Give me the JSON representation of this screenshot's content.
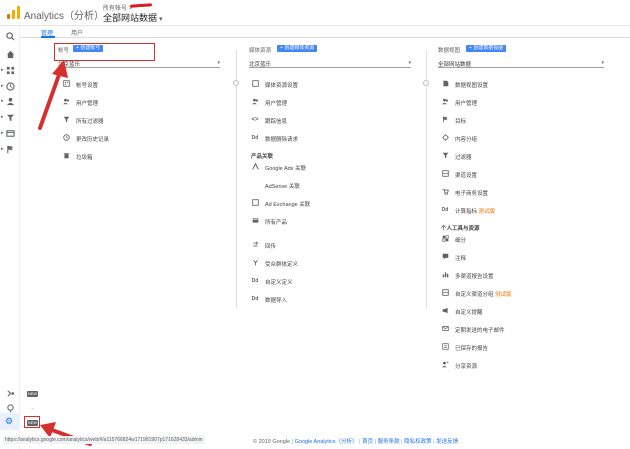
{
  "header": {
    "app_name": "Analytics（分析）",
    "account_path": "所有帐号 >",
    "property_view": "全部网站数据",
    "caret": "▾"
  },
  "tabs": [
    {
      "label": "管理",
      "active": true
    },
    {
      "label": "用户",
      "active": false
    }
  ],
  "nav_icons": [
    "search-icon",
    "home-icon",
    "customization-icon",
    "realtime-icon",
    "audience-icon",
    "acquisition-icon",
    "behavior-icon",
    "conversions-icon"
  ],
  "bottom_nav": {
    "badge": "NEW"
  },
  "account_column": {
    "header": "帐号",
    "create_label": "+ 创建帐号",
    "selector_value": "北京蓝乐",
    "items": [
      {
        "icon": "building-icon",
        "label": "帐号设置"
      },
      {
        "icon": "people-icon",
        "label": "用户管理"
      },
      {
        "icon": "filter-icon",
        "label": "所有过滤器"
      },
      {
        "icon": "history-icon",
        "label": "更改历史记录"
      },
      {
        "icon": "trash-icon",
        "label": "垃圾箱"
      }
    ]
  },
  "property_column": {
    "header": "媒体资源",
    "create_label": "+ 创建媒体资源",
    "selector_value": "北京蓝乐",
    "items": [
      {
        "icon": "square-icon",
        "label": "媒体资源设置"
      },
      {
        "icon": "people-icon",
        "label": "用户管理"
      },
      {
        "icon": "code-icon",
        "label": "跟踪信息"
      },
      {
        "icon": "dd-icon",
        "label": "数据删除请求"
      }
    ],
    "section_title": "产品关联",
    "product_items": [
      {
        "icon": "ads-icon",
        "label": "Google Ads 关联"
      },
      {
        "icon": "none",
        "label": "AdSense 关联"
      },
      {
        "icon": "adx-icon",
        "label": "Ad Exchange 关联"
      },
      {
        "icon": "products-icon",
        "label": "所有产品"
      }
    ],
    "other_items": [
      {
        "icon": "postback-icon",
        "label": "回传"
      },
      {
        "icon": "audience-icon",
        "label": "受众群体定义"
      },
      {
        "icon": "dd-icon",
        "label": "自定义定义"
      },
      {
        "icon": "dd-icon",
        "label": "数据导入"
      }
    ]
  },
  "view_column": {
    "header": "数据视图",
    "create_label": "+ 创建数据视图",
    "selector_value": "全部网站数据",
    "items": [
      {
        "icon": "doc-icon",
        "label": "数据视图设置"
      },
      {
        "icon": "people-icon",
        "label": "用户管理"
      },
      {
        "icon": "flag-icon",
        "label": "目标"
      },
      {
        "icon": "grouping-icon",
        "label": "内容分组"
      },
      {
        "icon": "filter-icon",
        "label": "过滤器"
      },
      {
        "icon": "channel-icon",
        "label": "渠道设置"
      },
      {
        "icon": "cart-icon",
        "label": "电子商务设置"
      },
      {
        "icon": "dd-icon",
        "label": "计算指标",
        "beta": "测试版"
      }
    ],
    "section_title": "个人工具与资源",
    "personal_items": [
      {
        "icon": "segment-icon",
        "label": "细分"
      },
      {
        "icon": "note-icon",
        "label": "注释"
      },
      {
        "icon": "bars-icon",
        "label": "多渠道报告设置"
      },
      {
        "icon": "channel-icon",
        "label": "自定义渠道分组",
        "beta": "测试版"
      },
      {
        "icon": "alert-icon",
        "label": "自定义提醒"
      },
      {
        "icon": "mail-icon",
        "label": "定期发送的电子邮件"
      },
      {
        "icon": "report-icon",
        "label": "已保存的报告"
      },
      {
        "icon": "share-icon",
        "label": "分享资源"
      }
    ]
  },
  "status_bar": {
    "url": "https://analytics.google.com/analytics/web/#/a115766824w171981907p171628433/admin"
  },
  "footer": {
    "copyright": "© 2019 Google",
    "links": [
      "Google Analytics（分析）",
      "首页",
      "服务条款",
      "隐私权政策",
      "发送反馈"
    ]
  },
  "annotation_color": "#d62f2f",
  "brand_colors": {
    "primary": "#1a73e8",
    "create_button": "#4285f4",
    "logo_orange": "#f9ab00"
  }
}
